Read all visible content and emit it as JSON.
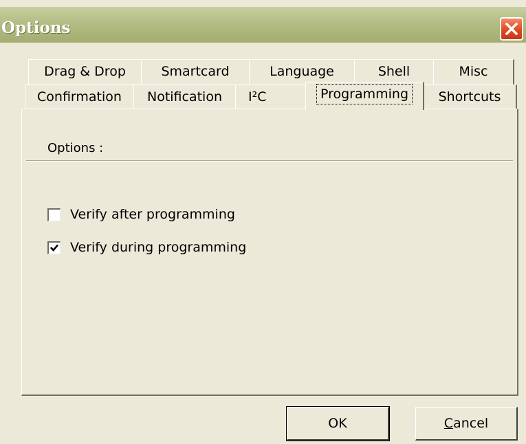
{
  "window": {
    "title": "Options",
    "close_icon": "close-icon"
  },
  "tabs": {
    "back_row": [
      {
        "label": "Drag & Drop"
      },
      {
        "label": "Smartcard"
      },
      {
        "label": "Language"
      },
      {
        "label": "Shell"
      },
      {
        "label": "Misc"
      }
    ],
    "front_row": [
      {
        "label": "Confirmation"
      },
      {
        "label": "Notification"
      },
      {
        "label": "I²C"
      },
      {
        "label": "Programming",
        "selected": true
      },
      {
        "label": "Shortcuts"
      }
    ]
  },
  "panel": {
    "group_label": "Options :",
    "options": [
      {
        "label": "Verify after programming",
        "checked": false
      },
      {
        "label": "Verify during programming",
        "checked": true
      }
    ]
  },
  "buttons": {
    "ok_label": "OK",
    "cancel_first": "C",
    "cancel_rest": "ancel"
  },
  "colors": {
    "window_bg": "#ece9d8",
    "titlebar": "#b3bd84",
    "close_button": "#e04a22"
  }
}
